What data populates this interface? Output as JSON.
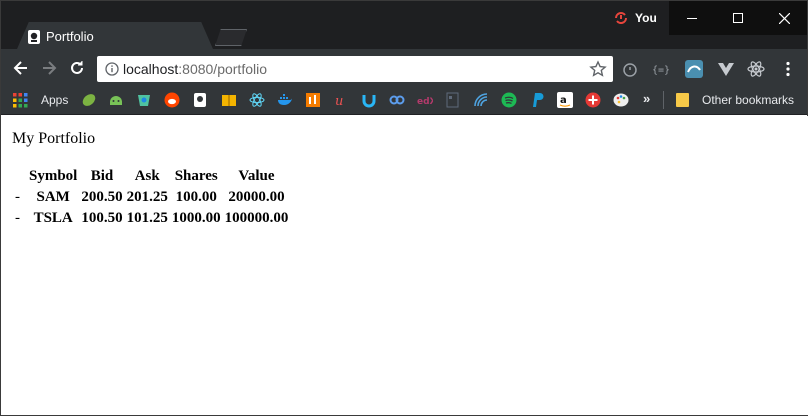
{
  "browser": {
    "tab": {
      "title": "Portfolio"
    },
    "profile": {
      "name": "You"
    },
    "url": {
      "host": "localhost",
      "path": ":8080/portfolio"
    },
    "bookmarks": {
      "apps_label": "Apps",
      "more": "»",
      "other_label": "Other bookmarks",
      "icons": [
        "leaf-icon",
        "android-icon",
        "chrome-store-icon",
        "reddit-icon",
        "book-icon",
        "package-icon",
        "react-icon",
        "docker-icon",
        "stackblitz-icon",
        "udemy-icon",
        "cloud-icon",
        "link-icon",
        "edx-icon",
        "grid-icon",
        "signal-icon",
        "spotify-icon",
        "paypal-icon",
        "amazon-icon",
        "plus-icon",
        "palette-icon"
      ]
    },
    "colors": {
      "titlebar": "#1e1f21",
      "toolbar": "#323639",
      "accent_sync": "#e8453c"
    }
  },
  "page": {
    "title": "My Portfolio",
    "table": {
      "headers": [
        "Symbol",
        "Bid",
        "Ask",
        "Shares",
        "Value"
      ],
      "rows": [
        {
          "dash": "-",
          "symbol": "SAM",
          "bid": "200.50",
          "ask": "201.25",
          "shares": "100.00",
          "value": "20000.00"
        },
        {
          "dash": "-",
          "symbol": "TSLA",
          "bid": "100.50",
          "ask": "101.25",
          "shares": "1000.00",
          "value": "100000.00"
        }
      ]
    }
  }
}
